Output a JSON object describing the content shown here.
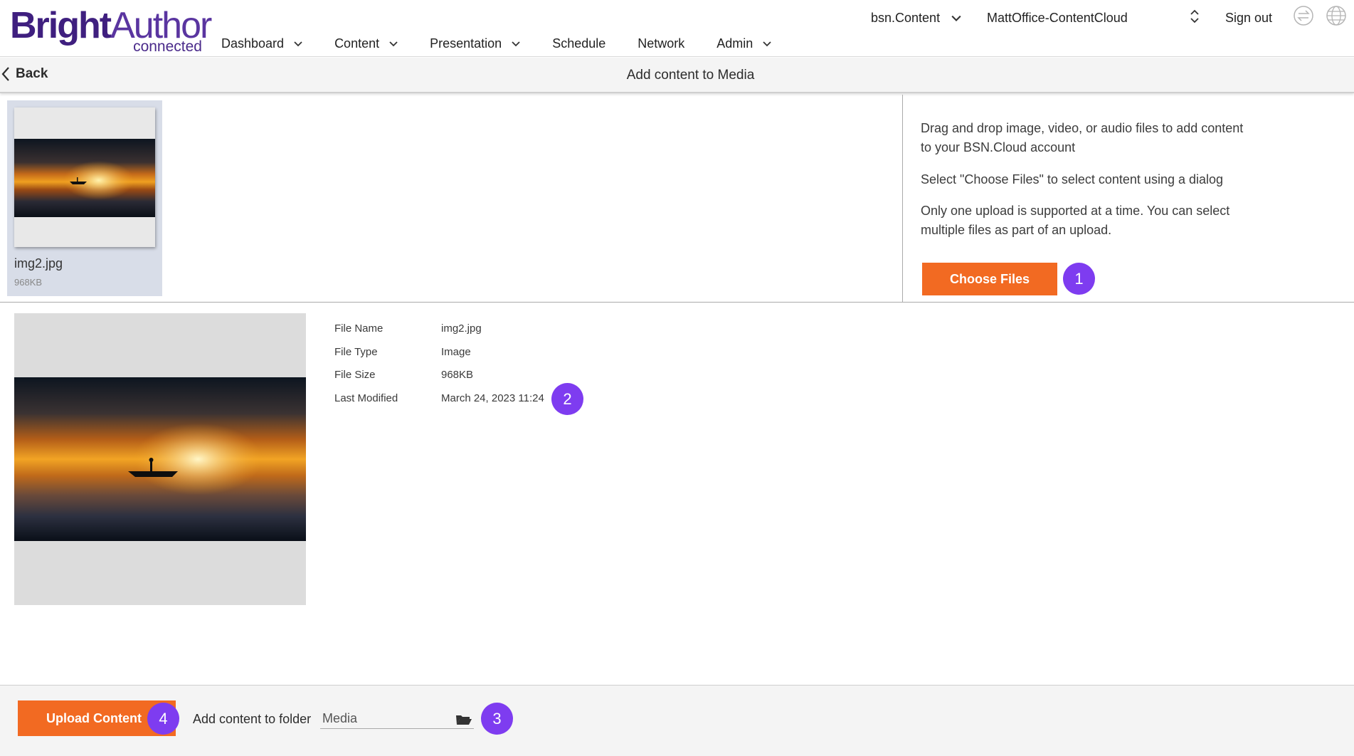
{
  "header": {
    "logo_bright": "Bright",
    "logo_author": "Author",
    "logo_sub": "connected",
    "nav": [
      {
        "label": "Dashboard",
        "has_menu": true
      },
      {
        "label": "Content",
        "has_menu": true
      },
      {
        "label": "Presentation",
        "has_menu": true
      },
      {
        "label": "Schedule",
        "has_menu": false
      },
      {
        "label": "Network",
        "has_menu": false
      },
      {
        "label": "Admin",
        "has_menu": true
      }
    ],
    "bsn_selector": "bsn.Content",
    "account_selector": "MattOffice-ContentCloud",
    "sign_out": "Sign out",
    "icons": [
      "exchange-icon",
      "globe-icon"
    ]
  },
  "subheader": {
    "back_label": "Back",
    "title": "Add content to Media"
  },
  "file_tile": {
    "name": "img2.jpg",
    "size": "968KB"
  },
  "instructions": {
    "line1": "Drag and drop image, video, or audio files to add content to your BSN.Cloud account",
    "line2": "Select \"Choose Files\" to select content using a dialog",
    "line3": "Only one upload is supported at a time. You can select multiple files as part of an upload.",
    "choose_files_label": "Choose Files"
  },
  "details": {
    "file_name_label": "File Name",
    "file_name": "img2.jpg",
    "file_type_label": "File Type",
    "file_type": "Image",
    "file_size_label": "File Size",
    "file_size": "968KB",
    "last_modified_label": "Last Modified",
    "last_modified": "March 24, 2023 11:24"
  },
  "footer": {
    "upload_label": "Upload Content",
    "folder_label": "Add content to folder",
    "folder_value": "Media"
  },
  "badges": [
    "1",
    "2",
    "3",
    "4"
  ],
  "colors": {
    "accent": "#f26a22",
    "badge": "#7e3cf0",
    "logo": "#4a2a8a"
  }
}
